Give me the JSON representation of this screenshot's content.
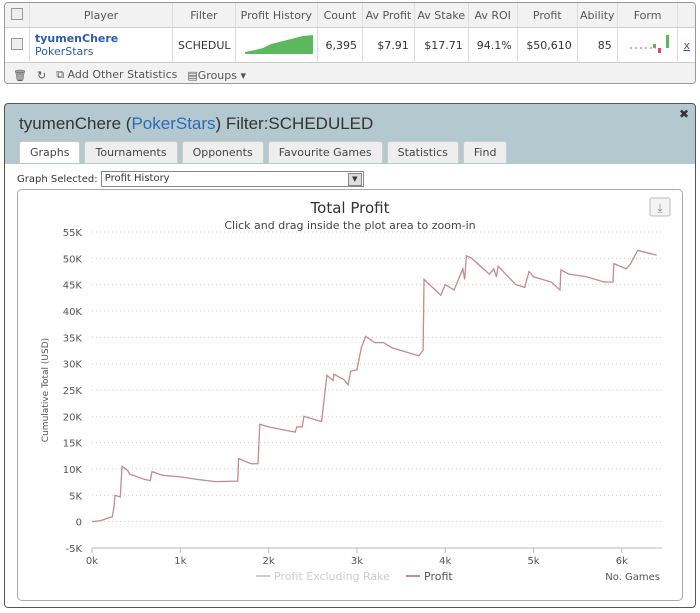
{
  "table": {
    "headers": [
      "Player",
      "Filter",
      "Profit History",
      "Count",
      "Av Profit",
      "Av Stake",
      "Av ROI",
      "Profit",
      "Ability",
      "Form"
    ],
    "row": {
      "player": "tyumenChere",
      "site": "PokerStars",
      "filter": "SCHEDUL",
      "count": "6,395",
      "av_profit": "$7.91",
      "av_stake": "$17.71",
      "av_roi": "94.1%",
      "profit": "$50,610",
      "ability": "85",
      "action": "x"
    },
    "footer": {
      "add_stats": "Add Other Statistics",
      "groups": "Groups"
    }
  },
  "dialog": {
    "player": "tyumenChere",
    "open_paren": " (",
    "site": "PokerStars",
    "filter": ") Filter:SCHEDULED",
    "close": "✖",
    "tabs": [
      "Graphs",
      "Tournaments",
      "Opponents",
      "Favourite Games",
      "Statistics",
      "Find"
    ],
    "active_tab": "Graphs",
    "graph_label": "Graph Selected:",
    "graph_value": "Profit History"
  },
  "chart_data": {
    "type": "line",
    "title": "Total Profit",
    "subtitle": "Click and drag inside the plot area to zoom-in",
    "xlabel": "No. Games",
    "ylabel": "Cumulative Total (USD)",
    "xlim": [
      0,
      6395
    ],
    "ylim": [
      -5000,
      55000
    ],
    "xticks": [
      "0k",
      "1k",
      "2k",
      "3k",
      "4k",
      "5k",
      "6k"
    ],
    "yticks": [
      "-5K",
      "0",
      "5K",
      "10K",
      "15K",
      "20K",
      "25K",
      "30K",
      "35K",
      "40K",
      "45K",
      "50K",
      "55K"
    ],
    "grid": "horizontal dotted",
    "legend_position": "bottom",
    "series": [
      {
        "name": "Profit Excluding Rake",
        "color": "#cccccc",
        "hidden": true,
        "points": []
      },
      {
        "name": "Profit",
        "color": "#c8898a",
        "points": [
          [
            0,
            0
          ],
          [
            100,
            200
          ],
          [
            200,
            800
          ],
          [
            230,
            900
          ],
          [
            250,
            3000
          ],
          [
            260,
            5000
          ],
          [
            320,
            4700
          ],
          [
            340,
            10500
          ],
          [
            400,
            9800
          ],
          [
            430,
            9000
          ],
          [
            600,
            8000
          ],
          [
            660,
            7800
          ],
          [
            680,
            9500
          ],
          [
            800,
            8800
          ],
          [
            1000,
            8500
          ],
          [
            1200,
            8000
          ],
          [
            1400,
            7600
          ],
          [
            1650,
            7700
          ],
          [
            1660,
            12000
          ],
          [
            1800,
            11000
          ],
          [
            1880,
            11000
          ],
          [
            1900,
            18500
          ],
          [
            2000,
            18000
          ],
          [
            2300,
            17000
          ],
          [
            2320,
            18000
          ],
          [
            2380,
            18000
          ],
          [
            2400,
            20000
          ],
          [
            2600,
            19000
          ],
          [
            2660,
            27800
          ],
          [
            2730,
            26800
          ],
          [
            2740,
            28000
          ],
          [
            2850,
            27000
          ],
          [
            2900,
            26000
          ],
          [
            2930,
            28600
          ],
          [
            3000,
            28800
          ],
          [
            3050,
            33000
          ],
          [
            3100,
            35200
          ],
          [
            3200,
            34000
          ],
          [
            3300,
            34000
          ],
          [
            3400,
            33000
          ],
          [
            3600,
            32000
          ],
          [
            3700,
            31500
          ],
          [
            3750,
            32500
          ],
          [
            3760,
            46000
          ],
          [
            3950,
            43000
          ],
          [
            4000,
            45000
          ],
          [
            4100,
            44000
          ],
          [
            4200,
            48000
          ],
          [
            4220,
            46000
          ],
          [
            4240,
            50500
          ],
          [
            4300,
            50000
          ],
          [
            4500,
            47000
          ],
          [
            4550,
            48000
          ],
          [
            4580,
            46500
          ],
          [
            4600,
            48500
          ],
          [
            4800,
            45000
          ],
          [
            4900,
            44500
          ],
          [
            4950,
            47500
          ],
          [
            5000,
            46500
          ],
          [
            5200,
            45500
          ],
          [
            5300,
            44000
          ],
          [
            5310,
            47800
          ],
          [
            5400,
            47000
          ],
          [
            5600,
            46500
          ],
          [
            5800,
            45500
          ],
          [
            5900,
            45500
          ],
          [
            5910,
            49000
          ],
          [
            6050,
            48000
          ],
          [
            6100,
            49000
          ],
          [
            6180,
            51500
          ],
          [
            6300,
            51000
          ],
          [
            6395,
            50600
          ]
        ]
      }
    ]
  }
}
